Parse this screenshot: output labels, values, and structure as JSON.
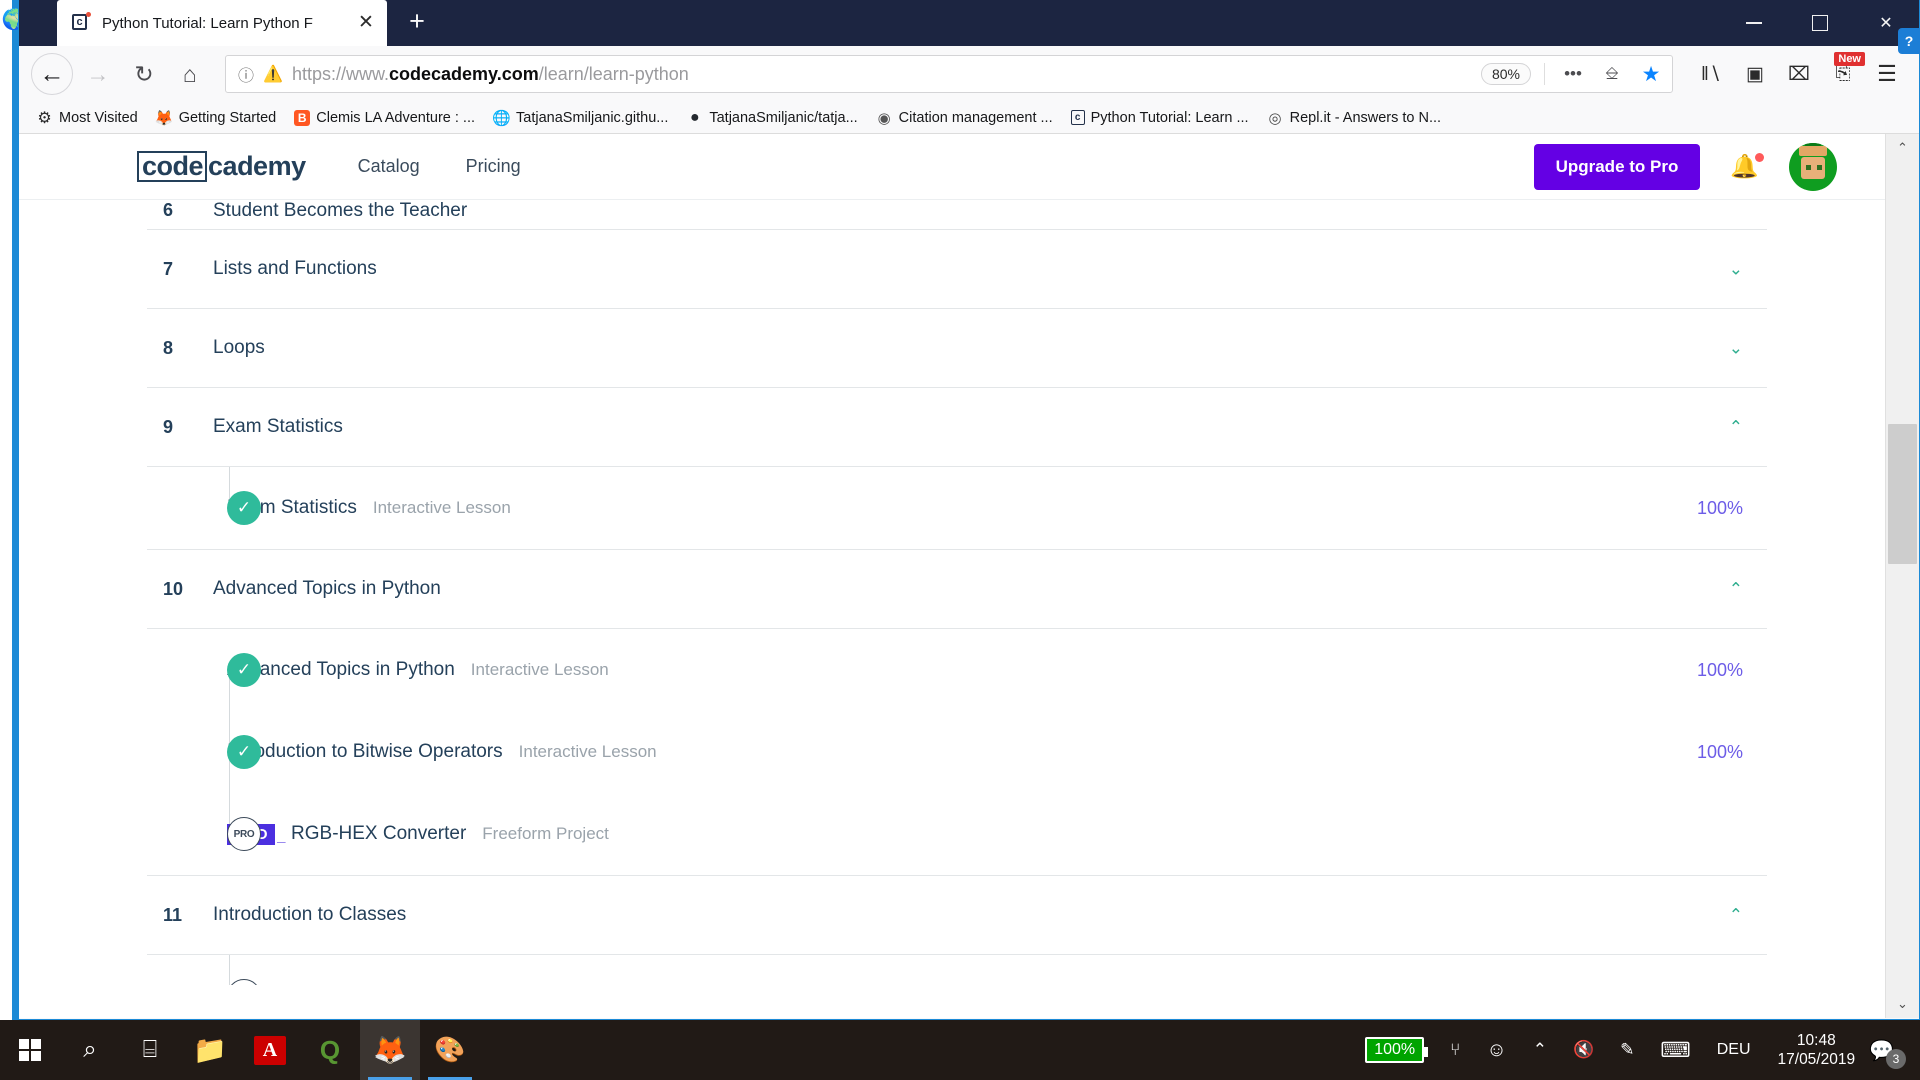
{
  "window": {
    "tab": {
      "title": "Python Tutorial: Learn Python F",
      "favicon_label": "c",
      "close_label": "✕"
    },
    "newtab_label": "+",
    "controls": {
      "minimize": "",
      "maximize": "",
      "close": "✕"
    }
  },
  "toolbar": {
    "back": "←",
    "forward": "→",
    "reload": "↻",
    "home": "⌂",
    "url_identity_icon": "ⓘ",
    "url_warning_icon": "⚠",
    "url_prefix": "https://www.",
    "url_domain": "codecademy.com",
    "url_path": "/learn/learn-python",
    "zoom_level": "80%",
    "page_actions": "•••",
    "pocket_icon": "♥",
    "bookmark_star": "★",
    "library_icon": "‖∖",
    "sidebar_icon": "▣",
    "screenshot_icon": "⌧",
    "new_badge": "New",
    "menu_icon": "☰"
  },
  "bookmarks": [
    {
      "label": "Most Visited",
      "icon": "gear-icon",
      "glyph": "⚙"
    },
    {
      "label": "Getting Started",
      "icon": "firefox-icon",
      "glyph": "🦊"
    },
    {
      "label": "Clemis LA Adventure : ...",
      "icon": "blogger-icon",
      "glyph": "B"
    },
    {
      "label": "TatjanaSmiljanic.githu...",
      "icon": "globe-icon",
      "glyph": "🌐"
    },
    {
      "label": "TatjanaSmiljanic/tatja...",
      "icon": "github-icon",
      "glyph": "●"
    },
    {
      "label": "Citation management ...",
      "icon": "citation-icon",
      "glyph": "◉"
    },
    {
      "label": "Python Tutorial: Learn ...",
      "icon": "codecademy-icon",
      "glyph": "c"
    },
    {
      "label": "Repl.it - Answers to N...",
      "icon": "replit-icon",
      "glyph": "◎"
    }
  ],
  "site_header": {
    "logo_boxed": "code",
    "logo_rest": "cademy",
    "nav": [
      {
        "label": "Catalog"
      },
      {
        "label": "Pricing"
      }
    ],
    "upgrade_button": "Upgrade to Pro",
    "bell_icon": "🔔",
    "avatar_name": "user-avatar"
  },
  "course": {
    "rows": [
      {
        "kind": "module",
        "partial": true,
        "number": "6",
        "title": "Student Becomes the Teacher",
        "chevron": ""
      },
      {
        "kind": "module",
        "number": "7",
        "title": "Lists and Functions",
        "chevron": "⌄",
        "expanded": false
      },
      {
        "kind": "module",
        "number": "8",
        "title": "Loops",
        "chevron": "⌄",
        "expanded": false
      },
      {
        "kind": "module",
        "number": "9",
        "title": "Exam Statistics",
        "chevron": "⌃",
        "expanded": true
      },
      {
        "kind": "lessons",
        "items": [
          {
            "status": "complete",
            "bullet": "✓",
            "title": "Exam Statistics",
            "type": "Interactive Lesson",
            "percent": "100%"
          }
        ]
      },
      {
        "kind": "module",
        "number": "10",
        "title": "Advanced Topics in Python",
        "chevron": "⌃",
        "expanded": true
      },
      {
        "kind": "lessons",
        "items": [
          {
            "status": "complete",
            "bullet": "✓",
            "title": "Advanced Topics in Python",
            "type": "Interactive Lesson",
            "percent": "100%"
          },
          {
            "status": "complete",
            "bullet": "✓",
            "title": "Introduction to Bitwise Operators",
            "type": "Interactive Lesson",
            "percent": "100%"
          },
          {
            "status": "pro",
            "bullet": "PRO",
            "tag": "PRO",
            "title": "RGB-HEX Converter",
            "type": "Freeform Project",
            "percent": ""
          }
        ]
      },
      {
        "kind": "module",
        "number": "11",
        "title": "Introduction to Classes",
        "chevron": "⌃",
        "expanded": true
      }
    ]
  },
  "scrollbar": {
    "up_arrow": "⌃",
    "down_arrow": "⌄"
  },
  "taskbar": {
    "items": [
      {
        "name": "start-button",
        "glyph": ""
      },
      {
        "name": "search-icon",
        "glyph": "⌕"
      },
      {
        "name": "task-view-icon",
        "glyph": "⌸"
      },
      {
        "name": "file-explorer-icon",
        "glyph": "🗁"
      },
      {
        "name": "adobe-reader-icon",
        "glyph": "A"
      },
      {
        "name": "qgis-icon",
        "glyph": "Q"
      },
      {
        "name": "firefox-icon",
        "glyph": "🦊"
      },
      {
        "name": "paint-icon",
        "glyph": "🎨"
      }
    ],
    "tray": {
      "battery_percent": "100%",
      "plug_icon": "⑂",
      "people_icon": "&",
      "chevron_up": "⌃",
      "volume_muted_icon": "🔇",
      "pen_icon": "✎",
      "keyboard_icon": "⌨",
      "language": "DEU",
      "time": "10:48",
      "date": "17/05/2019",
      "notification_count": "3"
    }
  },
  "colors": {
    "brand_purple": "#6400e4",
    "pro_tag": "#4b2fe0",
    "complete_green": "#2fbb9b",
    "percent_text": "#6c5ce7",
    "tabstrip": "#1c2541",
    "heading_navy": "#24405a"
  }
}
